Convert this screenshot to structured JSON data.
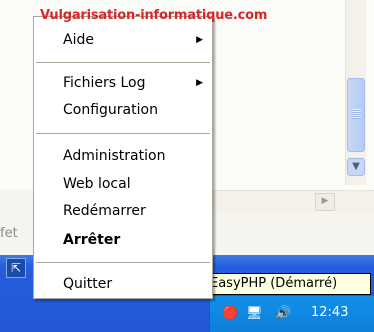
{
  "watermark": "Vulgarisation-informatique.com",
  "menu": {
    "items": [
      {
        "label": "Aide",
        "submenu": true
      },
      {
        "label": "Fichiers Log",
        "submenu": true
      },
      {
        "label": "Configuration",
        "submenu": false
      },
      {
        "label": "Administration",
        "submenu": false
      },
      {
        "label": "Web local",
        "submenu": false
      },
      {
        "label": "Redémarrer",
        "submenu": false
      },
      {
        "label": "Arrêter",
        "submenu": false,
        "bold": true
      },
      {
        "label": "Quitter",
        "submenu": false
      }
    ]
  },
  "background": {
    "partial_text": "fet"
  },
  "tooltip": "EasyPHP (Démarré)",
  "taskbar": {
    "clock": "12:43"
  },
  "colors": {
    "watermark": "#D8262A",
    "taskbar": "#245EDC",
    "tooltip_bg": "#FFFFE1"
  },
  "icons": {
    "submenu_arrow": "triangle-right",
    "scroll_down": "chevron-down",
    "scroll_right": "triangle-right"
  }
}
